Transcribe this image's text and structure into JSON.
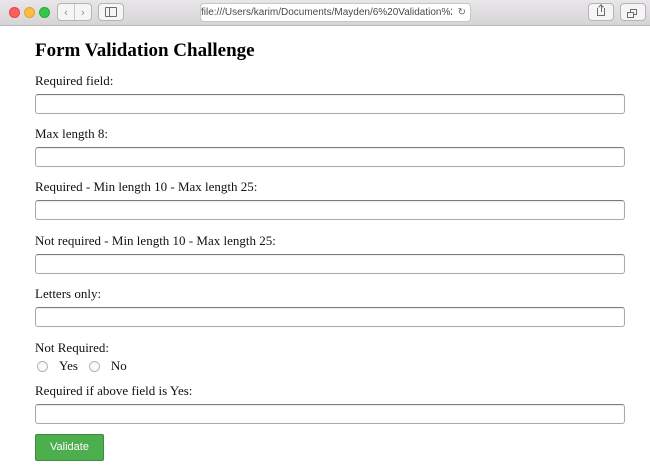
{
  "browser": {
    "url": "file:///Users/karim/Documents/Mayden/6%20Validation%2",
    "back_icon": "chevron-left-icon",
    "forward_icon": "chevron-right-icon",
    "reload_icon": "reload-icon",
    "share_icon": "share-icon",
    "tabs_icon": "tabs-icon"
  },
  "page": {
    "title": "Form Validation Challenge"
  },
  "form": {
    "fields": [
      {
        "label": "Required field:",
        "value": ""
      },
      {
        "label": "Max length 8:",
        "value": ""
      },
      {
        "label": "Required - Min length 10 - Max length 25:",
        "value": ""
      },
      {
        "label": "Not required - Min length 10 - Max length 25:",
        "value": ""
      },
      {
        "label": "Letters only:",
        "value": ""
      }
    ],
    "radio_group": {
      "label": "Not Required:",
      "options": [
        {
          "label": "Yes",
          "checked": false
        },
        {
          "label": "No",
          "checked": false
        }
      ]
    },
    "conditional_field": {
      "label": "Required if above field is Yes:",
      "value": ""
    },
    "submit_label": "Validate"
  },
  "colors": {
    "validate_button": "#4cae4c",
    "window_red": "#fc605c",
    "window_yellow": "#fdbc40",
    "window_green": "#34c84a"
  }
}
